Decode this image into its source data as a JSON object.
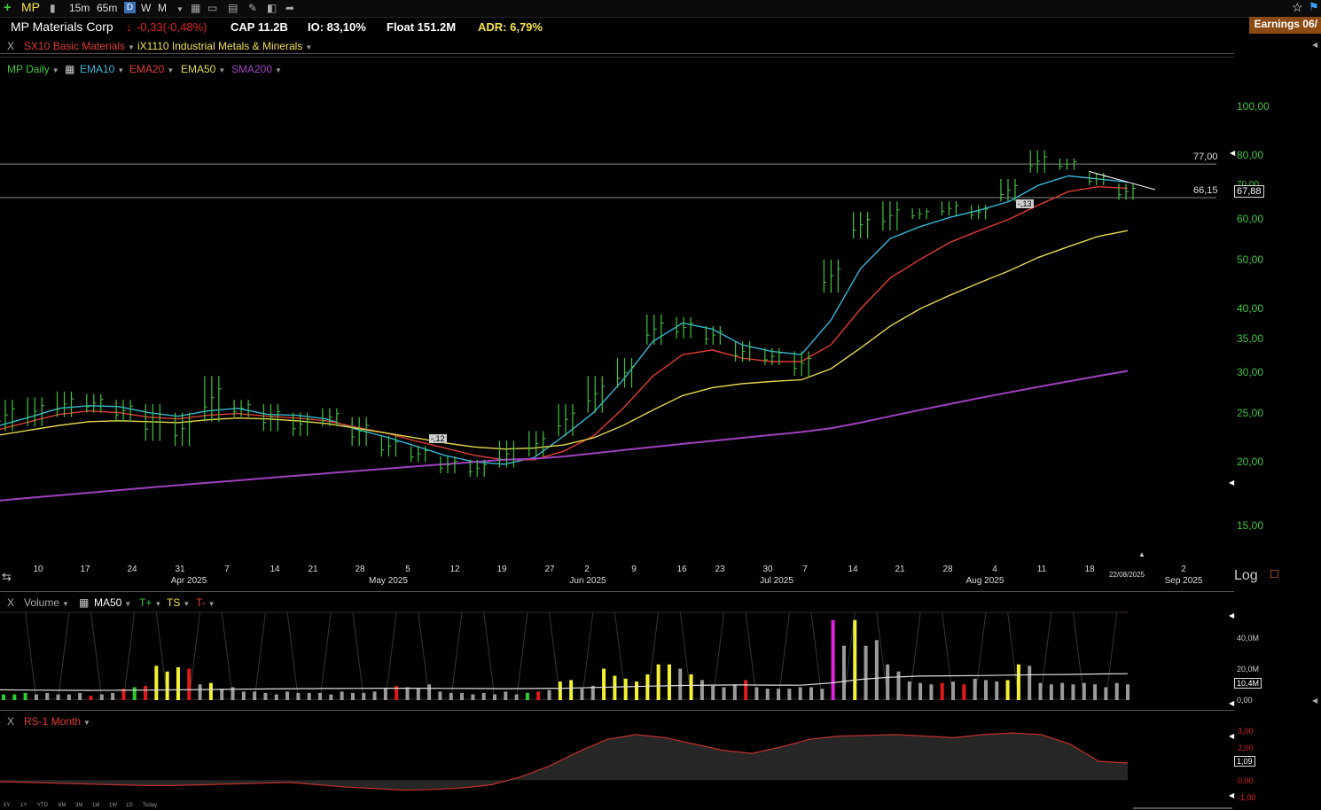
{
  "toolbar": {
    "symbol": "MP",
    "intervals": [
      "15m",
      "65m"
    ],
    "periods": [
      "D",
      "W",
      "M"
    ],
    "earnings": "Earnings 06/"
  },
  "info": {
    "company": "MP Materials Corp",
    "change": "-0,33(-0,48%)",
    "cap": "CAP 11.2B",
    "io": "IO: 83,10%",
    "float": "Float 151.2M",
    "adr": "ADR: 6,79%"
  },
  "sector": {
    "close": "X",
    "sector": "SX10 Basic Materials",
    "industry": "iX1110 Industrial Metals & Minerals"
  },
  "legend": {
    "items": [
      {
        "label": "MP Daily",
        "color": "#3fc43f"
      },
      {
        "label": "EMA10",
        "color": "#33b7d8"
      },
      {
        "label": "EMA20",
        "color": "#e03c32"
      },
      {
        "label": "EMA50",
        "color": "#e6d84a"
      },
      {
        "label": "SMA200",
        "color": "#a040c0"
      }
    ]
  },
  "chart_data": {
    "type": "line",
    "title": "MP Daily",
    "y_scale": "log",
    "ylim": [
      13.5,
      125
    ],
    "y_ticks": [
      "100,00",
      "80,00",
      "70,00",
      "60,00",
      "50,00",
      "40,00",
      "35,00",
      "30,00",
      "25,00",
      "20,00",
      "15,00"
    ],
    "y_tick_values": [
      100,
      80,
      70,
      60,
      50,
      40,
      35,
      30,
      25,
      20,
      15
    ],
    "last_price": "67,88",
    "horizontal_lines": [
      {
        "value": 77.0,
        "label": "77,00"
      },
      {
        "value": 66.15,
        "label": "66,15"
      }
    ],
    "markers": [
      {
        "label": "-,12",
        "x_index": 24
      },
      {
        "label": "-,13",
        "x_index": 110
      }
    ],
    "x_day_ticks": [
      "10",
      "17",
      "24",
      "31",
      "7",
      "14",
      "21",
      "28",
      "5",
      "12",
      "19",
      "27",
      "2",
      "9",
      "16",
      "23",
      "30",
      "7",
      "14",
      "21",
      "28",
      "4",
      "11",
      "18",
      "22/08/2025",
      "2"
    ],
    "x_month_ticks": [
      "Apr 2025",
      "May 2025",
      "Jun 2025",
      "Jul 2025",
      "Aug 2025",
      "Sep 2025"
    ],
    "log_label": "Log",
    "series": [
      {
        "name": "EMA10",
        "color": "#33b7d8",
        "values": [
          23.6,
          24.5,
          25.5,
          25.8,
          25.7,
          25.0,
          24.6,
          25.2,
          25.5,
          24.8,
          24.7,
          24.3,
          23.2,
          22.4,
          21.5,
          20.6,
          20.0,
          19.8,
          20.4,
          22.5,
          25.0,
          29.0,
          34.5,
          37.5,
          36.5,
          34.0,
          33.0,
          32.5,
          38.0,
          48.0,
          55.0,
          58.0,
          60.5,
          62.5,
          65.0,
          70.0,
          73.0,
          72.0,
          71.0
        ]
      },
      {
        "name": "EMA20",
        "color": "#e03c32",
        "values": [
          23.2,
          24.0,
          24.8,
          25.2,
          25.0,
          24.5,
          24.3,
          24.7,
          24.9,
          24.6,
          24.4,
          24.1,
          23.4,
          22.8,
          22.0,
          21.3,
          20.6,
          20.2,
          20.2,
          21.0,
          22.5,
          25.5,
          29.5,
          32.5,
          33.2,
          32.0,
          31.5,
          31.5,
          34.0,
          40.0,
          46.0,
          50.0,
          54.0,
          57.0,
          60.0,
          64.0,
          68.0,
          69.5,
          69.0
        ]
      },
      {
        "name": "EMA50",
        "color": "#e6d84a",
        "values": [
          22.6,
          23.1,
          23.6,
          24.0,
          24.1,
          24.0,
          23.9,
          24.2,
          24.4,
          24.3,
          24.1,
          23.8,
          23.3,
          22.8,
          22.3,
          21.8,
          21.4,
          21.2,
          21.3,
          21.6,
          22.3,
          23.6,
          25.3,
          27.0,
          28.0,
          28.5,
          28.8,
          29.0,
          30.5,
          33.5,
          37.0,
          40.0,
          42.5,
          45.0,
          47.5,
          50.5,
          53.0,
          55.5,
          57.0
        ]
      },
      {
        "name": "SMA200",
        "color": "#a040c0",
        "values": [
          16.8,
          17.0,
          17.2,
          17.4,
          17.6,
          17.8,
          18.0,
          18.2,
          18.4,
          18.6,
          18.8,
          19.0,
          19.2,
          19.4,
          19.6,
          19.8,
          20.0,
          20.2,
          20.3,
          20.5,
          20.8,
          21.1,
          21.4,
          21.7,
          22.0,
          22.3,
          22.6,
          22.9,
          23.3,
          23.9,
          24.6,
          25.3,
          26.0,
          26.7,
          27.4,
          28.1,
          28.8,
          29.5,
          30.2
        ]
      }
    ],
    "price_bars": [
      [
        23.0,
        26.5
      ],
      [
        23.5,
        26.8
      ],
      [
        24.5,
        27.5
      ],
      [
        25.0,
        27.2
      ],
      [
        24.0,
        26.5
      ],
      [
        22.0,
        26.0
      ],
      [
        21.5,
        25.0
      ],
      [
        24.0,
        29.5
      ],
      [
        24.5,
        26.5
      ],
      [
        23.0,
        26.0
      ],
      [
        22.5,
        25.0
      ],
      [
        23.5,
        25.5
      ],
      [
        21.5,
        24.5
      ],
      [
        20.5,
        22.5
      ],
      [
        20.0,
        21.5
      ],
      [
        19.0,
        20.5
      ],
      [
        18.7,
        20.2
      ],
      [
        19.5,
        22.0
      ],
      [
        20.5,
        23.0
      ],
      [
        22.5,
        26.0
      ],
      [
        25.0,
        29.5
      ],
      [
        28.0,
        32.0
      ],
      [
        34.0,
        39.0
      ],
      [
        35.0,
        38.5
      ],
      [
        34.0,
        37.0
      ],
      [
        31.5,
        34.5
      ],
      [
        31.0,
        33.5
      ],
      [
        29.5,
        33.0
      ],
      [
        43.0,
        50.0
      ],
      [
        55.0,
        62.0
      ],
      [
        57.0,
        65.0
      ],
      [
        60.0,
        63.0
      ],
      [
        61.0,
        65.0
      ],
      [
        60.0,
        64.0
      ],
      [
        65.0,
        72.0
      ],
      [
        74.0,
        82.0
      ],
      [
        75.0,
        79.0
      ],
      [
        70.0,
        74.0
      ],
      [
        65.5,
        70.5
      ]
    ]
  },
  "volume_panel": {
    "close": "X",
    "title": "Volume",
    "ma_label": "MA50",
    "t_plus": "T+",
    "ts": "TS",
    "t_minus": "T-",
    "y_ticks": [
      "40,0M",
      "20,0M",
      "0,00"
    ],
    "y_tick_values": [
      40,
      20,
      0
    ],
    "ylim": [
      0,
      62
    ],
    "current": "10.4M",
    "ma_values": [
      7.2,
      7.0,
      6.9,
      6.8,
      6.9,
      7.0,
      7.2,
      7.4,
      7.6,
      7.8,
      8.0,
      8.1,
      8.2,
      8.3,
      8.3,
      8.2,
      8.1,
      8.0,
      8.1,
      8.3,
      8.8,
      9.3,
      9.8,
      10.2,
      10.5,
      10.6,
      10.5,
      10.4,
      12.0,
      14.5,
      16.0,
      16.8,
      17.0,
      17.2,
      17.5,
      17.8,
      18.0,
      18.3,
      18.5
    ],
    "bars": [
      [
        4,
        "g"
      ],
      [
        4,
        "g"
      ],
      [
        5,
        "g"
      ],
      [
        4,
        "gr"
      ],
      [
        5,
        "gr"
      ],
      [
        4,
        "gr"
      ],
      [
        4,
        "gr"
      ],
      [
        5,
        "gr"
      ],
      [
        3,
        "r"
      ],
      [
        4,
        "gr"
      ],
      [
        5,
        "gr"
      ],
      [
        8,
        "r"
      ],
      [
        9,
        "g"
      ],
      [
        10,
        "r"
      ],
      [
        24,
        "y"
      ],
      [
        20,
        "y"
      ],
      [
        23,
        "y"
      ],
      [
        22,
        "r"
      ],
      [
        11,
        "gr"
      ],
      [
        12,
        "y"
      ],
      [
        8,
        "gr"
      ],
      [
        9,
        "gr"
      ],
      [
        6,
        "gr"
      ],
      [
        6,
        "gr"
      ],
      [
        5,
        "gr"
      ],
      [
        4,
        "gr"
      ],
      [
        6,
        "gr"
      ],
      [
        5,
        "gr"
      ],
      [
        5,
        "gr"
      ],
      [
        5,
        "gr"
      ],
      [
        4,
        "gr"
      ],
      [
        6,
        "gr"
      ],
      [
        5,
        "gr"
      ],
      [
        5,
        "gr"
      ],
      [
        6,
        "gr"
      ],
      [
        8,
        "gr"
      ],
      [
        10,
        "r"
      ],
      [
        9,
        "gr"
      ],
      [
        8,
        "gr"
      ],
      [
        11,
        "gr"
      ],
      [
        6,
        "gr"
      ],
      [
        5,
        "gr"
      ],
      [
        5,
        "gr"
      ],
      [
        4,
        "gr"
      ],
      [
        5,
        "gr"
      ],
      [
        4,
        "gr"
      ],
      [
        6,
        "gr"
      ],
      [
        4,
        "gr"
      ],
      [
        5,
        "g"
      ],
      [
        6,
        "r"
      ],
      [
        7,
        "gr"
      ],
      [
        13,
        "y"
      ],
      [
        14,
        "y"
      ],
      [
        8,
        "gr"
      ],
      [
        10,
        "gr"
      ],
      [
        22,
        "y"
      ],
      [
        17,
        "y"
      ],
      [
        15,
        "y"
      ],
      [
        13,
        "y"
      ],
      [
        18,
        "y"
      ],
      [
        25,
        "y"
      ],
      [
        25,
        "y"
      ],
      [
        22,
        "gr"
      ],
      [
        18,
        "y"
      ],
      [
        14,
        "gr"
      ],
      [
        10,
        "gr"
      ],
      [
        9,
        "gr"
      ],
      [
        11,
        "gr"
      ],
      [
        14,
        "r"
      ],
      [
        9,
        "gr"
      ],
      [
        8,
        "gr"
      ],
      [
        8,
        "gr"
      ],
      [
        8,
        "gr"
      ],
      [
        9,
        "gr"
      ],
      [
        9,
        "gr"
      ],
      [
        8,
        "gr"
      ],
      [
        56,
        "m"
      ],
      [
        38,
        "gr"
      ],
      [
        56,
        "y"
      ],
      [
        38,
        "gr"
      ],
      [
        42,
        "gr"
      ],
      [
        25,
        "gr"
      ],
      [
        20,
        "gr"
      ],
      [
        13,
        "gr"
      ],
      [
        12,
        "gr"
      ],
      [
        11,
        "gr"
      ],
      [
        12,
        "r"
      ],
      [
        13,
        "gr"
      ],
      [
        11,
        "r"
      ],
      [
        15,
        "gr"
      ],
      [
        14,
        "gr"
      ],
      [
        13,
        "gr"
      ],
      [
        14,
        "y"
      ],
      [
        25,
        "y"
      ],
      [
        24,
        "gr"
      ],
      [
        12,
        "gr"
      ],
      [
        11,
        "gr"
      ],
      [
        12,
        "gr"
      ],
      [
        11,
        "gr"
      ],
      [
        12,
        "gr"
      ],
      [
        11,
        "gr"
      ],
      [
        9,
        "gr"
      ],
      [
        12,
        "gr"
      ],
      [
        11,
        "gr"
      ]
    ]
  },
  "rs_panel": {
    "close": "X",
    "title": "RS-1 Month",
    "y_ticks": [
      "3,00",
      "2,00",
      "0,00",
      "-1,00"
    ],
    "y_tick_values": [
      3,
      2,
      0,
      -1
    ],
    "ylim": [
      -1.4,
      3.4
    ],
    "current": "1,09",
    "values": [
      -0.1,
      -0.15,
      -0.2,
      -0.25,
      -0.3,
      -0.35,
      -0.35,
      -0.3,
      -0.25,
      -0.2,
      -0.15,
      -0.3,
      -0.45,
      -0.55,
      -0.65,
      -0.6,
      -0.5,
      -0.3,
      0.2,
      0.9,
      1.8,
      2.6,
      2.9,
      2.7,
      2.3,
      1.9,
      1.7,
      2.1,
      2.6,
      2.8,
      2.85,
      2.9,
      2.8,
      2.7,
      2.9,
      3.0,
      2.9,
      2.3,
      1.2,
      1.09
    ]
  },
  "range_buttons": [
    "5Y",
    "1Y",
    "YTD",
    "6M",
    "3M",
    "1M",
    "1W",
    "1D",
    "Today"
  ],
  "colors": {
    "up": "#3fc43f",
    "volume_green": "#2ecc2e",
    "volume_red": "#e01a1a",
    "volume_yellow": "#f2f230",
    "volume_gray": "#9a9a9a",
    "volume_magenta": "#e020e0",
    "rs_line": "#c0302a"
  }
}
